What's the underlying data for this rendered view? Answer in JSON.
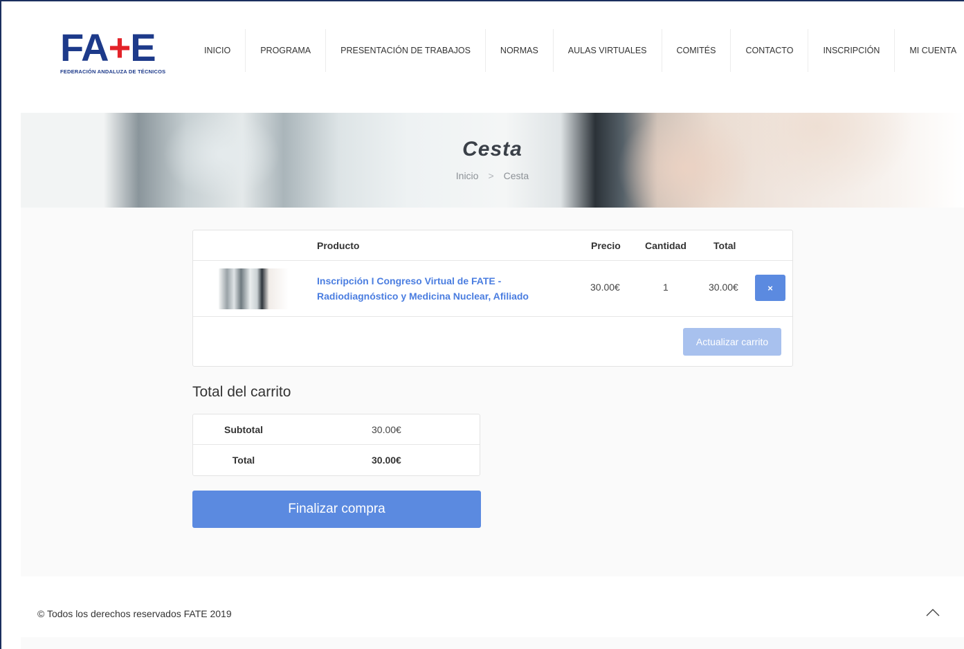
{
  "brand": {
    "logo_part1": "FA",
    "logo_plus": "+",
    "logo_part2": "E",
    "logo_subtitle": "FEDERACIÓN ANDALUZA DE TÉCNICOS",
    "accent_color": "#5b8ae0",
    "logo_blue": "#1d3a8a",
    "logo_red": "#e32329"
  },
  "nav": {
    "items": [
      {
        "label": "INICIO"
      },
      {
        "label": "PROGRAMA"
      },
      {
        "label": "PRESENTACIÓN DE TRABAJOS"
      },
      {
        "label": "NORMAS"
      },
      {
        "label": "AULAS VIRTUALES"
      },
      {
        "label": "COMITÉS"
      },
      {
        "label": "CONTACTO"
      },
      {
        "label": "INSCRIPCIÓN"
      },
      {
        "label": "MI CUENTA"
      }
    ]
  },
  "banner": {
    "title": "Cesta",
    "breadcrumb": [
      "Inicio",
      "Cesta"
    ],
    "breadcrumb_separator": ">"
  },
  "cart": {
    "headers": {
      "product": "Producto",
      "price": "Precio",
      "quantity": "Cantidad",
      "total": "Total"
    },
    "items": [
      {
        "name": "Inscripción I Congreso Virtual de FATE - Radiodiagnóstico y Medicina Nuclear, Afiliado",
        "price": "30.00€",
        "quantity": "1",
        "total": "30.00€",
        "remove_label": "×"
      }
    ],
    "update_label": "Actualizar carrito"
  },
  "totals": {
    "title": "Total del carrito",
    "subtotal_label": "Subtotal",
    "subtotal_value": "30.00€",
    "total_label": "Total",
    "total_value": "30.00€"
  },
  "checkout_label": "Finalizar compra",
  "footer": {
    "copyright": "© Todos los derechos reservados FATE 2019",
    "to_top_icon": "chevron-up-icon"
  }
}
